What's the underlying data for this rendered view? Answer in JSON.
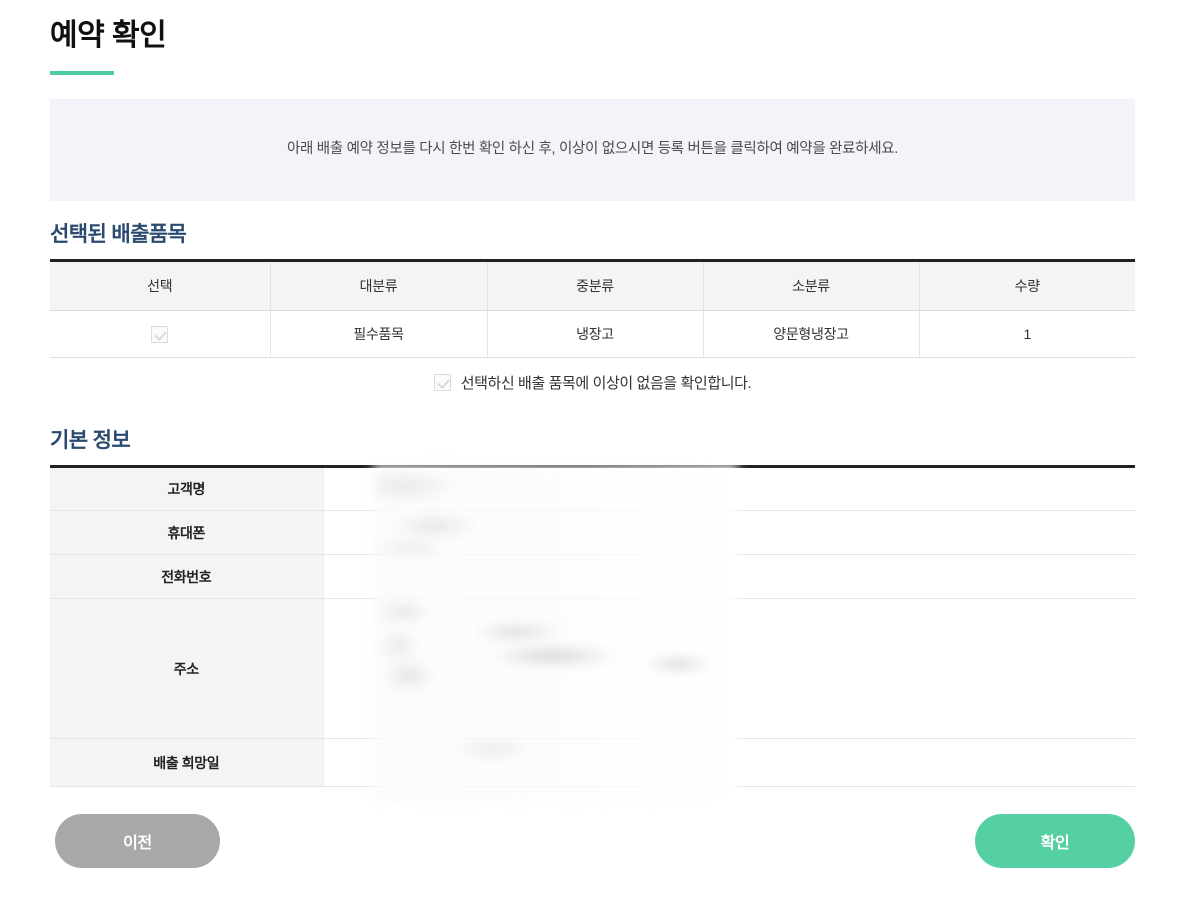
{
  "page": {
    "title": "예약 확인",
    "accent_color": "#4ecca3",
    "heading_color": "#2b4a6f"
  },
  "notice": {
    "text": "아래 배출 예약 정보를 다시 한번 확인 하신 후, 이상이 없으시면 등록 버튼을 클릭하여 예약을 완료하세요.",
    "background_color": "#f2f4f9"
  },
  "items_section": {
    "heading": "선택된 배출품목",
    "columns": [
      "선택",
      "대분류",
      "중분류",
      "소분류",
      "수량"
    ],
    "rows": [
      {
        "selected": true,
        "major_category": "필수품목",
        "middle_category": "냉장고",
        "sub_category": "양문형냉장고",
        "quantity": "1"
      }
    ],
    "confirm_checkbox": {
      "checked": true,
      "label": "선택하신 배출 품목에 이상이 없음을 확인합니다."
    }
  },
  "info_section": {
    "heading": "기본 정보",
    "rows": [
      {
        "label": "고객명",
        "value": ""
      },
      {
        "label": "휴대폰",
        "value": ""
      },
      {
        "label": "전화번호",
        "value": ""
      },
      {
        "label": "주소",
        "value": ""
      },
      {
        "label": "배출 희망일",
        "value": ""
      }
    ]
  },
  "footer": {
    "prev_label": "이전",
    "confirm_label": "확인",
    "prev_color": "#a8a8a8",
    "confirm_color": "#55d0a3"
  }
}
